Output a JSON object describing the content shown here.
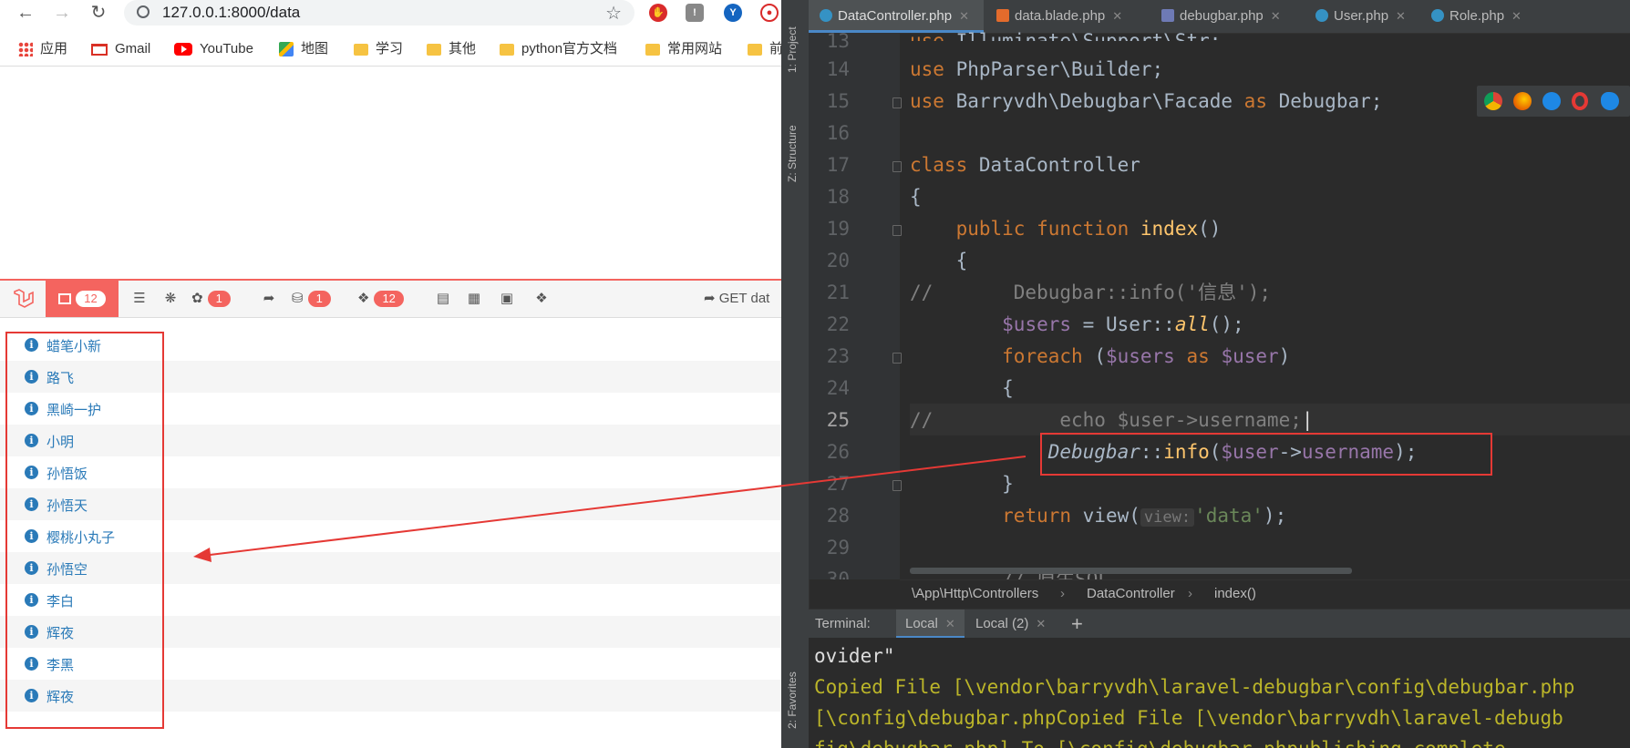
{
  "browser": {
    "url": "127.0.0.1:8000/data",
    "bookmarks": [
      {
        "label": "应用",
        "icon": "apps-icon"
      },
      {
        "label": "Gmail",
        "icon": "gmail-icon"
      },
      {
        "label": "YouTube",
        "icon": "youtube-icon"
      },
      {
        "label": "地图",
        "icon": "maps-icon"
      },
      {
        "label": "学习",
        "icon": "folder-icon"
      },
      {
        "label": "其他",
        "icon": "folder-icon"
      },
      {
        "label": "python官方文档",
        "icon": "folder-icon"
      },
      {
        "label": "常用网站",
        "icon": "folder-icon"
      },
      {
        "label": "前",
        "icon": "folder-icon"
      }
    ]
  },
  "debugbar": {
    "badges": {
      "messages": "12",
      "timeline": "1",
      "queries": "1",
      "models": "12"
    },
    "request_label": "GET dat",
    "accent": "#f4645f",
    "messages": [
      "蜡笔小新",
      "路飞",
      "黑崎一护",
      "小明",
      "孙悟饭",
      "孙悟天",
      "樱桃小丸子",
      "孙悟空",
      "李白",
      "辉夜",
      "李黑",
      "辉夜"
    ]
  },
  "ide": {
    "tool_windows": {
      "project": "1: Project",
      "structure": "Z: Structure",
      "favorites": "2: Favorites"
    },
    "tabs": [
      {
        "label": "DataController.php",
        "active": true
      },
      {
        "label": "data.blade.php",
        "active": false
      },
      {
        "label": "debugbar.php",
        "active": false
      },
      {
        "label": "User.php",
        "active": false
      },
      {
        "label": "Role.php",
        "active": false
      }
    ],
    "lines": [
      "13",
      "14",
      "15",
      "16",
      "17",
      "18",
      "19",
      "20",
      "21",
      "22",
      "23",
      "24",
      "25",
      "26",
      "27",
      "28",
      "29",
      "30"
    ],
    "breadcrumb": [
      "\\App\\Http\\Controllers",
      "DataController",
      "index()"
    ],
    "terminal": {
      "label": "Terminal:",
      "tabs": [
        "Local",
        "Local (2)"
      ],
      "lines": [
        "ovider\"",
        "Copied File [\\vendor\\barryvdh\\laravel-debugbar\\config\\debugbar.php",
        "[\\config\\debugbar.phpCopied File [\\vendor\\barryvdh\\laravel-debugb",
        "fig\\debugbar.php] To [\\config\\debugbar.phpublishing complete."
      ]
    }
  }
}
